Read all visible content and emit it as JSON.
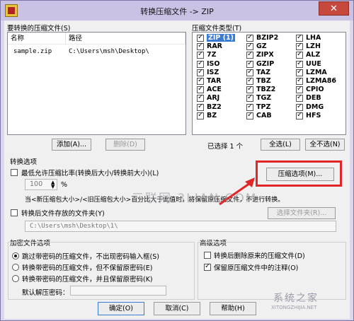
{
  "window": {
    "title": "转换压缩文件 -> ZIP",
    "close_glyph": "✕"
  },
  "files": {
    "label": "要转换的压缩文件(S)",
    "columns": [
      "名称",
      "路径"
    ],
    "rows": [
      {
        "name": "sample.zip",
        "path": "C:\\Users\\msh\\Desktop\\"
      }
    ],
    "add_label": "添加(A)...",
    "delete_label": "删除(D)"
  },
  "types": {
    "label": "压缩文件类型(T)",
    "items": [
      {
        "name": "ZIP (1)",
        "checked": true
      },
      {
        "name": "BZIP2",
        "checked": true
      },
      {
        "name": "LHA",
        "checked": true
      },
      {
        "name": "RAR",
        "checked": true
      },
      {
        "name": "GZ",
        "checked": true
      },
      {
        "name": "LZH",
        "checked": true
      },
      {
        "name": "7Z",
        "checked": true
      },
      {
        "name": "ZIPX",
        "checked": true
      },
      {
        "name": "ALZ",
        "checked": true
      },
      {
        "name": "ISO",
        "checked": true
      },
      {
        "name": "GZIP",
        "checked": true
      },
      {
        "name": "UUE",
        "checked": true
      },
      {
        "name": "ISZ",
        "checked": true
      },
      {
        "name": "TAZ",
        "checked": true
      },
      {
        "name": "LZMA",
        "checked": true
      },
      {
        "name": "TAR",
        "checked": true
      },
      {
        "name": "TBZ",
        "checked": true
      },
      {
        "name": "LZMA86",
        "checked": true
      },
      {
        "name": "ACE",
        "checked": true
      },
      {
        "name": "TBZ2",
        "checked": true
      },
      {
        "name": "CPIO",
        "checked": true
      },
      {
        "name": "ARJ",
        "checked": true
      },
      {
        "name": "TGZ",
        "checked": true
      },
      {
        "name": "DEB",
        "checked": true
      },
      {
        "name": "BZ2",
        "checked": true
      },
      {
        "name": "TPZ",
        "checked": true
      },
      {
        "name": "DMG",
        "checked": true
      },
      {
        "name": "BZ",
        "checked": true
      },
      {
        "name": "CAB",
        "checked": true
      },
      {
        "name": "HFS",
        "checked": true
      }
    ],
    "selected_count": "已选择 1 个",
    "select_all_label": "全选(L)",
    "select_none_label": "全不选(N)"
  },
  "convert_options": {
    "label": "转换选项",
    "min_ratio_label": "最低允许压缩比率(转换后大小/转换前大小)(L)",
    "ratio_value": "100",
    "ratio_unit": "%",
    "note": "当<新压缩包大小>/<旧压缩包大小>百分比大于此值时，将保留原压缩文件，不进行转换。",
    "compress_options_label": "压缩选项(M)...",
    "save_folder_label": "转换后文件存放的文件夹(Y)",
    "folder_path": "C:\\Users\\msh\\Desktop\\1\\",
    "choose_folder_label": "选择文件夹(R)..."
  },
  "encryption": {
    "label": "加密文件选项",
    "options": [
      "跳过带密码的压缩文件，不出现密码输入框(S)",
      "转换带密码的压缩文件，但不保留原密码(E)",
      "转换带密码的压缩文件，并且保留原密码(K)"
    ],
    "selected_index": 0,
    "default_password_label": "默认解压密码："
  },
  "advanced": {
    "label": "高级选项",
    "delete_original_label": "转换后删除原来的压缩文件(D)",
    "delete_original_checked": false,
    "keep_comment_label": "保留原压缩文件中的注释(O)",
    "keep_comment_checked": true
  },
  "footer": {
    "ok_label": "确定(O)",
    "cancel_label": "取消(C)",
    "help_label": "帮助(H)"
  },
  "watermark": {
    "center": "三联网 3LIAN.COM",
    "corner": "系统之家",
    "corner_sub": "XITONGZHIJIA.NET"
  },
  "colors": {
    "highlight": "#e02626",
    "selected": "#3a7bd5"
  }
}
